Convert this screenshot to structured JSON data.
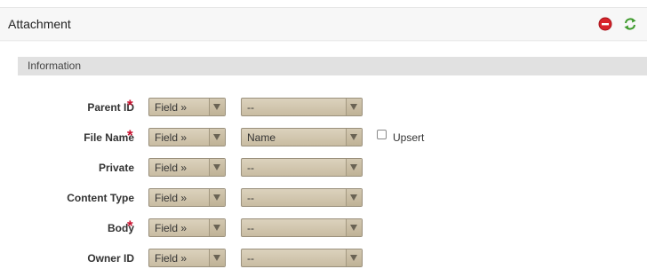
{
  "panel": {
    "title": "Attachment",
    "icons": {
      "remove": "remove-icon",
      "refresh": "refresh-icon"
    }
  },
  "section": {
    "title": "Information"
  },
  "required_marker": "*",
  "colors": {
    "required": "#c8102e",
    "remove": "#d8232a",
    "refresh": "#3e9a2c"
  },
  "fields": [
    {
      "label": "Parent ID",
      "required": true,
      "type": "Field »",
      "value": "--"
    },
    {
      "label": "File Name",
      "required": true,
      "type": "Field »",
      "value": "Name",
      "upsert_label": "Upsert",
      "upsert_checked": false
    },
    {
      "label": "Private",
      "required": false,
      "type": "Field »",
      "value": "--"
    },
    {
      "label": "Content Type",
      "required": false,
      "type": "Field »",
      "value": "--"
    },
    {
      "label": "Body",
      "required": true,
      "type": "Field »",
      "value": "--"
    },
    {
      "label": "Owner ID",
      "required": false,
      "type": "Field »",
      "value": "--"
    }
  ]
}
